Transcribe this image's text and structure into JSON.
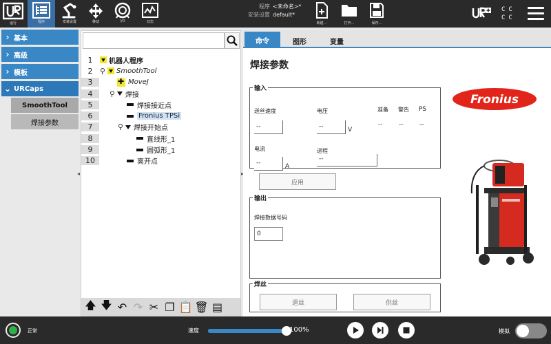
{
  "topbar": {
    "logo_text": "UR",
    "nav": [
      {
        "label": "运行"
      },
      {
        "label": "程序"
      },
      {
        "label": "安装设置"
      },
      {
        "label": "移动"
      },
      {
        "label": "I/O"
      },
      {
        "label": "日志"
      }
    ],
    "program_key": "程序",
    "program_value": "<未命名>*",
    "install_key": "安装设置",
    "install_value": "default*",
    "file_buttons": [
      {
        "label": "新建..."
      },
      {
        "label": "打开..."
      },
      {
        "label": "保存..."
      }
    ],
    "cc_text": "CC CC"
  },
  "leftnav": {
    "items": [
      {
        "label": "基本"
      },
      {
        "label": "高级"
      },
      {
        "label": "模板"
      },
      {
        "label": "URCaps"
      }
    ],
    "subitems": [
      {
        "label": "SmoothTool"
      },
      {
        "label": "焊接参数"
      }
    ]
  },
  "tree": {
    "rows": [
      {
        "num": "1",
        "text": "机器人程序"
      },
      {
        "num": "2",
        "text": "SmoothTool"
      },
      {
        "num": "3",
        "text": "MoveJ"
      },
      {
        "num": "4",
        "text": "焊接"
      },
      {
        "num": "5",
        "text": "焊接接近点"
      },
      {
        "num": "6",
        "text": "Fronius TPSi"
      },
      {
        "num": "7",
        "text": "焊接开始点"
      },
      {
        "num": "8",
        "text": "直线形_1"
      },
      {
        "num": "9",
        "text": "圆弧形_1"
      },
      {
        "num": "10",
        "text": "离开点"
      }
    ]
  },
  "right": {
    "tabs": [
      {
        "label": "命令"
      },
      {
        "label": "图形"
      },
      {
        "label": "变量"
      }
    ],
    "title": "焊接参数",
    "input_group": {
      "legend": "输入",
      "wire_speed_label": "送丝速度",
      "wire_speed_value": "--",
      "voltage_label": "电压",
      "voltage_value": "--",
      "voltage_unit": "V",
      "current_label": "电流",
      "current_value": "--",
      "current_unit": "A",
      "job_label": "进程",
      "job_value": "--",
      "status_headers": [
        "准备",
        "警告",
        "PS"
      ],
      "status_values": [
        "--",
        "--",
        "--"
      ]
    },
    "apply_label": "应用",
    "output_group": {
      "legend": "输出",
      "job_number_label": "焊接数据号码",
      "job_number_value": "0"
    },
    "wire_group": {
      "legend": "焊丝",
      "retract_label": "退丝",
      "feed_label": "供丝"
    },
    "brand_logo_text": "Fronius"
  },
  "bottombar": {
    "status_label": "正常",
    "speed_label": "速度",
    "speed_value_text": "100%",
    "speed_fraction": 1.0,
    "sim_label": "模拟"
  },
  "colors": {
    "accent": "#3a87c6",
    "topbar": "#2a2a2a",
    "fronius_red": "#e1251b",
    "status_green": "#2fb14a",
    "highlight_yellow": "#f2e72a"
  }
}
